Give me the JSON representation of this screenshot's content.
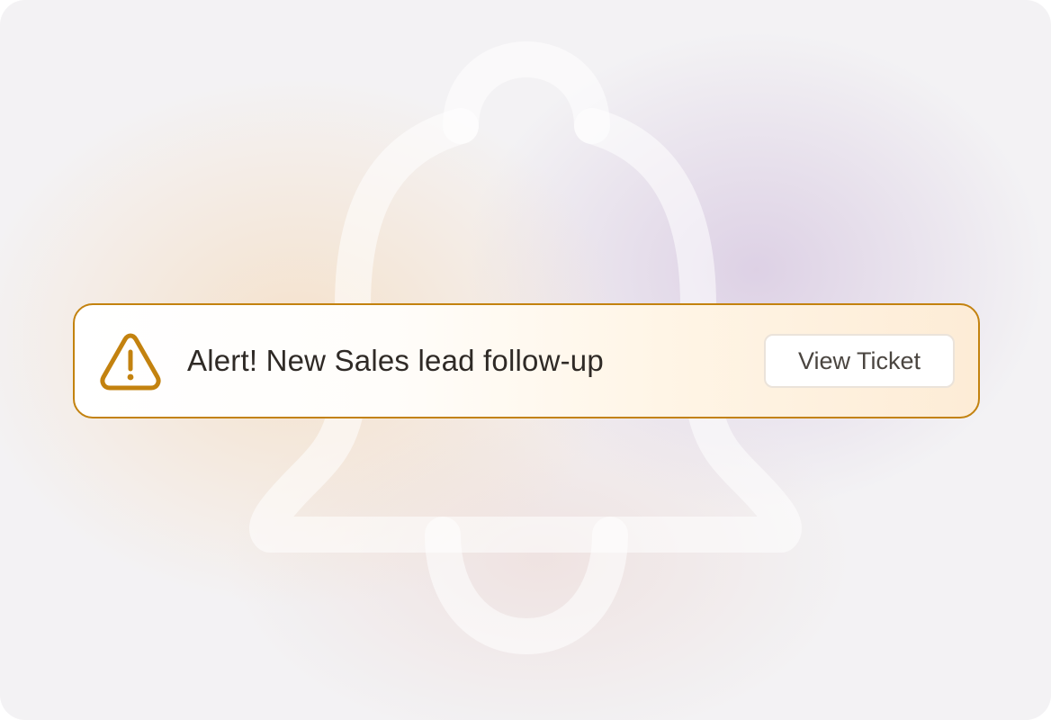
{
  "alert": {
    "icon": "warning-triangle-icon",
    "message": "Alert! New Sales lead follow-up",
    "action_label": "View Ticket",
    "accent_color": "#c3820f"
  },
  "background": {
    "icon": "bell-icon"
  }
}
